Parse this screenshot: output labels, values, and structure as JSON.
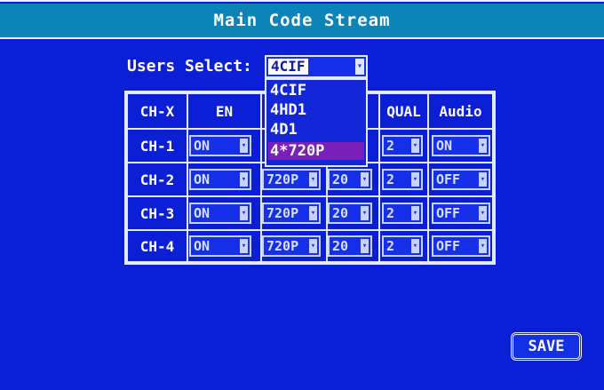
{
  "window": {
    "title": "Main Code Stream"
  },
  "users_select": {
    "label": "Users Select:",
    "value": "4CIF",
    "options": [
      "4CIF",
      "4HD1",
      "4D1",
      "4*720P"
    ],
    "highlighted_option": "4*720P"
  },
  "table": {
    "headers": [
      "CH-X",
      "EN",
      "",
      "",
      "QUAL",
      "Audio"
    ],
    "rows": [
      {
        "ch": "CH-1",
        "en": "ON",
        "res": "",
        "fps": "",
        "qual": "2",
        "audio": "ON"
      },
      {
        "ch": "CH-2",
        "en": "ON",
        "res": "720P",
        "fps": "20",
        "qual": "2",
        "audio": "OFF"
      },
      {
        "ch": "CH-3",
        "en": "ON",
        "res": "720P",
        "fps": "20",
        "qual": "2",
        "audio": "OFF"
      },
      {
        "ch": "CH-4",
        "en": "ON",
        "res": "720P",
        "fps": "20",
        "qual": "2",
        "audio": "OFF"
      }
    ]
  },
  "buttons": {
    "save": "SAVE"
  },
  "colors": {
    "background": "#0b1fd6",
    "titlebar": "#0d84b7",
    "highlight": "#7a1fb8"
  },
  "icons": {
    "dropdown_arrow": "chevron-down-icon"
  }
}
